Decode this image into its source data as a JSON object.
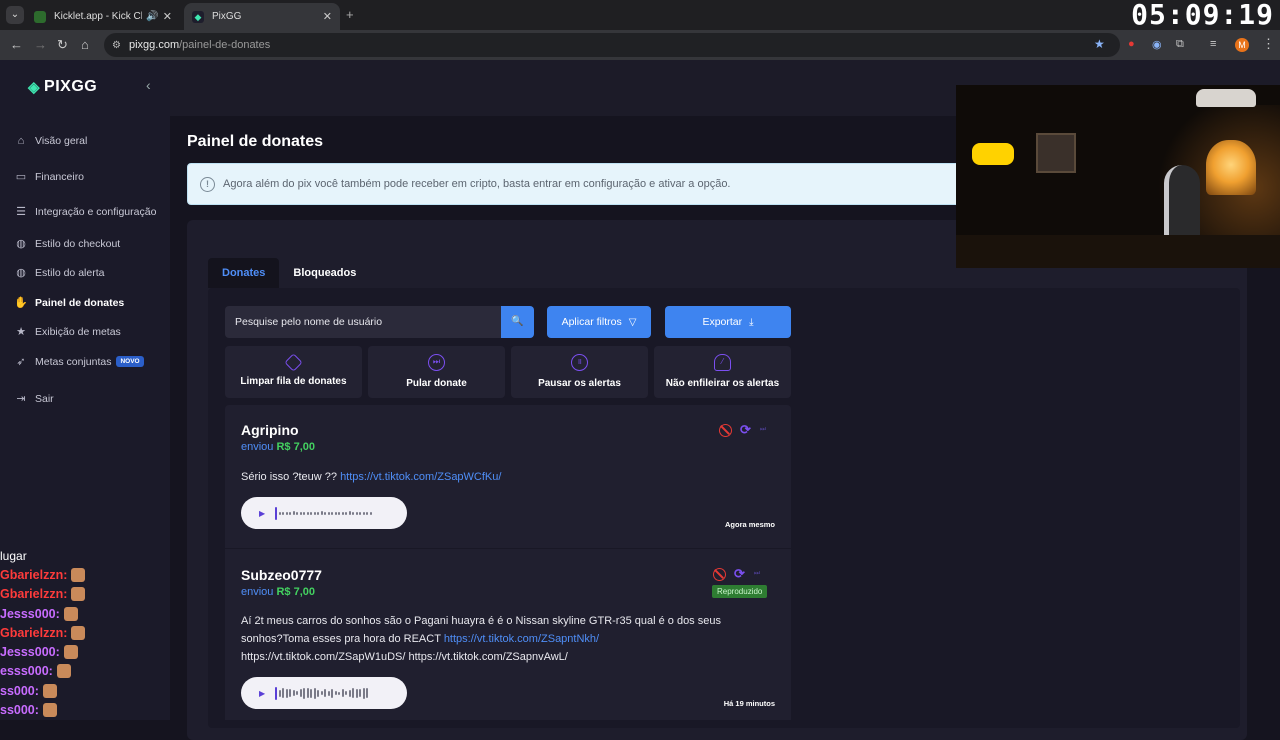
{
  "browser": {
    "tabs": [
      {
        "title": "Kicklet.app - Kick Chatbot a",
        "active": false,
        "audio": true
      },
      {
        "title": "PixGG",
        "active": true,
        "audio": false
      }
    ],
    "url_host": "pixgg.com",
    "url_path": "/painel-de-donates",
    "clock": "05:09:19"
  },
  "sidebar": {
    "logo": "PIXGG",
    "items": [
      {
        "label": "Visão geral",
        "icon": "home-icon",
        "active": false
      },
      {
        "label": "Financeiro",
        "icon": "wallet-icon",
        "active": false
      },
      {
        "label": "Integração e configuração",
        "icon": "settings-icon",
        "active": false
      },
      {
        "label": "Estilo do checkout",
        "icon": "palette-icon",
        "active": false
      },
      {
        "label": "Estilo do alerta",
        "icon": "palette-icon",
        "active": false
      },
      {
        "label": "Painel de donates",
        "icon": "donate-hand-icon",
        "active": true
      },
      {
        "label": "Exibição de metas",
        "icon": "star-icon",
        "active": false
      },
      {
        "label": "Metas conjuntas",
        "icon": "rocket-icon",
        "active": false,
        "badge": "NOVO"
      },
      {
        "label": "Sair",
        "icon": "logout-icon",
        "active": false
      }
    ]
  },
  "chat": [
    {
      "name": "lugar",
      "color": "#ffffff"
    },
    {
      "name": "Gbarielzzn:",
      "color": "#ff3b3b"
    },
    {
      "name": "Gbarielzzn:",
      "color": "#ff3b3b"
    },
    {
      "name": "Jesss000:",
      "color": "#c86cff"
    },
    {
      "name": "Gbarielzzn:",
      "color": "#ff3b3b"
    },
    {
      "name": "Jesss000:",
      "color": "#c86cff"
    },
    {
      "name": "esss000:",
      "color": "#c86cff"
    },
    {
      "name": "ss000:",
      "color": "#c86cff"
    },
    {
      "name": "ss000:",
      "color": "#c86cff"
    }
  ],
  "main": {
    "title": "Painel de donates",
    "info": "Agora além do pix você também pode receber em cripto, basta entrar em configuração e ativar a opção.",
    "tabs": [
      "Donates",
      "Bloqueados"
    ],
    "search_placeholder": "Pesquise pelo nome de usuário",
    "filter_label": "Aplicar filtros",
    "export_label": "Exportar",
    "actions": [
      "Limpar fila de donates",
      "Pular donate",
      "Pausar os alertas",
      "Não enfileirar os alertas"
    ],
    "donates": [
      {
        "name": "Agripino",
        "sent": "enviou",
        "amount": "R$ 7,00",
        "message": "Sério isso ?teuw ??",
        "links": [
          "https://vt.tiktok.com/ZSapWCfKu/"
        ],
        "time": "Agora mesmo",
        "status": ""
      },
      {
        "name": "Subzeo0777",
        "sent": "enviou",
        "amount": "R$ 7,00",
        "message_1": "Aí 2t meus carros do sonhos são o Pagani huayra é é o Nissan skyline GTR-r35 qual é o dos seus sonhos?Toma esses pra hora do REACT",
        "link_1": "https://vt.tiktok.com/ZSapntNkh/",
        "message_2": "https://vt.tiktok.com/ZSapW1uDS/ https://vt.tiktok.com/ZSapnvAwL/",
        "time": "Há 19 minutos",
        "status": "Reproduzido"
      }
    ]
  },
  "colors": {
    "accent": "#3e84f0",
    "amount": "#43d160",
    "ban": "#e53935",
    "purple": "#7b4ff0",
    "played": "#2e7d32"
  }
}
